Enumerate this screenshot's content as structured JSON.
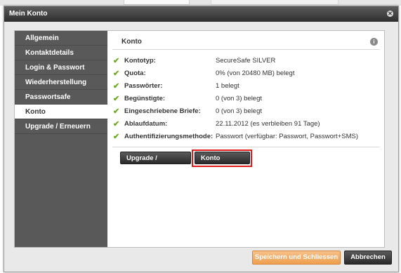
{
  "dialog": {
    "title": "Mein Konto",
    "close_icon": "close-icon"
  },
  "sidebar": {
    "items": [
      {
        "label": "Allgemein",
        "active": false
      },
      {
        "label": "Kontaktdetails",
        "active": false
      },
      {
        "label": "Login & Passwort",
        "active": false
      },
      {
        "label": "Wiederherstellung",
        "active": false
      },
      {
        "label": "Passwortsafe",
        "active": false
      },
      {
        "label": "Konto",
        "active": true
      },
      {
        "label": "Upgrade / Erneuern",
        "active": false
      }
    ]
  },
  "panel": {
    "title": "Konto",
    "info_icon": "info-icon",
    "rows": [
      {
        "label": "Kontotyp:",
        "value": "SecureSafe SILVER"
      },
      {
        "label": "Quota:",
        "value": "0% (von 20480 MB) belegt"
      },
      {
        "label": "Passwörter:",
        "value": "1 belegt"
      },
      {
        "label": "Begünstigte:",
        "value": "0 (von 3) belegt"
      },
      {
        "label": "Eingeschriebene Briefe:",
        "value": "0 (von 3) belegt"
      },
      {
        "label": "Ablaufdatum:",
        "value": "22.11.2012 (es verbleiben 91 Tage)"
      },
      {
        "label": "Authentifizierungsmethode:",
        "value": "Passwort (verfügbar: Passwort, Passwort+SMS)"
      }
    ],
    "buttons": {
      "upgrade": "Upgrade / Erneuern",
      "delete": "Konto löschen"
    }
  },
  "footer": {
    "save": "Speichern und Schliessen",
    "cancel": "Abbrechen"
  },
  "colors": {
    "highlight": "#e21a1a",
    "check": "#6aaa1a",
    "save_button": "#ee9f4e"
  }
}
